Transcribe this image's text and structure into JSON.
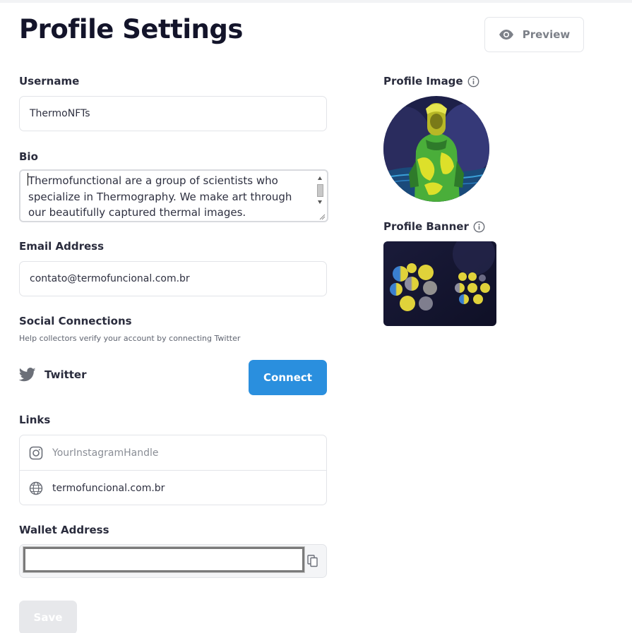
{
  "page": {
    "title": "Profile Settings"
  },
  "header": {
    "preview_label": "Preview"
  },
  "form": {
    "username": {
      "label": "Username",
      "value": "ThermoNFTs"
    },
    "bio": {
      "label": "Bio",
      "value": "Thermofunctional are a group of scientists who specialize in Thermography. We make art through our beautifully captured thermal images."
    },
    "email": {
      "label": "Email Address",
      "value": "contato@termofuncional.com.br"
    },
    "social": {
      "label": "Social Connections",
      "helper": "Help collectors verify your account by connecting Twitter",
      "twitter_label": "Twitter",
      "connect_label": "Connect"
    },
    "links": {
      "label": "Links",
      "instagram_placeholder": "YourInstagramHandle",
      "website_value": "termofuncional.com.br"
    },
    "wallet": {
      "label": "Wallet Address",
      "value": ""
    },
    "save_label": "Save"
  },
  "sidebar": {
    "profile_image_label": "Profile Image",
    "profile_banner_label": "Profile Banner"
  },
  "colors": {
    "accent": "#2a8fde",
    "title": "#13142a",
    "border": "#e2e4e8",
    "save_disabled": "#e7e8eb"
  },
  "icons": [
    "eye-icon",
    "info-icon",
    "twitter-icon",
    "instagram-icon",
    "globe-icon",
    "copy-icon"
  ]
}
